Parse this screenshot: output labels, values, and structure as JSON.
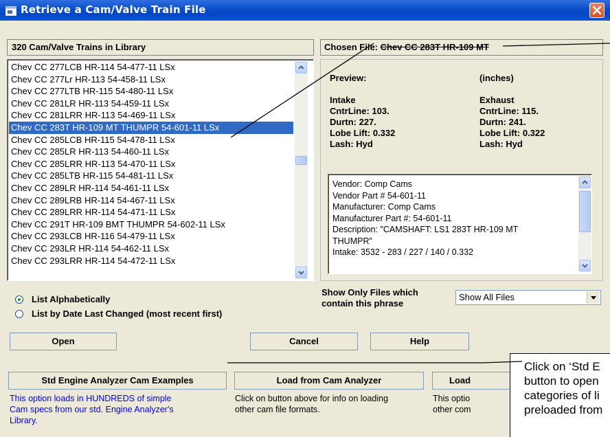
{
  "window": {
    "title": "Retrieve a Cam/Valve Train File",
    "close_label": "X"
  },
  "library": {
    "count_label": "320 Cam/Valve Trains in Library",
    "items": [
      "Chev CC  277LCB HR-114 54-477-11 LSx",
      "Chev CC  277Lr HR-113 54-458-11 LSx",
      "Chev CC  277LTB HR-115 54-480-11 LSx",
      "Chev CC  281LR HR-113 54-459-11 LSx",
      "Chev CC  281LRR HR-113 54-469-11 LSx",
      "Chev CC  283T HR-109 MT THUMPR 54-601-11 LSx",
      "Chev CC  285LCB HR-115 54-478-11 LSx",
      "Chev CC  285LR HR-113 54-460-11 LSx",
      "Chev CC  285LRR HR-113 54-470-11 LSx",
      "Chev CC  285LTB HR-115 54-481-11 LSx",
      "Chev CC  289LR HR-114 54-461-11 LSx",
      "Chev CC  289LRB HR-114 54-467-11 LSx",
      "Chev CC  289LRR HR-114 54-471-11 LSx",
      "Chev CC  291T HR-109 BMT THUMPR 54-602-11 LSx",
      "Chev CC  293LCB HR-116 54-479-11 LSx",
      "Chev CC  293LR HR-114 54-462-11 LSx",
      "Chev CC  293LRR HR-114 54-472-11 LSx"
    ],
    "selected_index": 5
  },
  "chosen": {
    "prefix": "Chosen File: ",
    "name": "Chev CC  283T HR-109 MT"
  },
  "preview": {
    "heading": "Preview:",
    "units": "(inches)",
    "intake": {
      "title": "Intake",
      "centerline": "CntrLine: 103.",
      "duration": "Durtn: 227.",
      "lobe_lift": "Lobe Lift: 0.332",
      "lash": "Lash: Hyd"
    },
    "exhaust": {
      "title": "Exhaust",
      "centerline": "CntrLine: 115.",
      "duration": "Durtn: 241.",
      "lobe_lift": "Lobe Lift: 0.322",
      "lash": "Lash: Hyd"
    },
    "notes": [
      "Vendor: Comp Cams",
      "Vendor Part # 54-601-11",
      "Manufacturer: Comp Cams",
      "Manufacturer Part #: 54-601-11",
      "Description: \"CAMSHAFT: LS1 283T HR-109 MT",
      "THUMPR\"",
      "Intake: 3532 - 283 / 227 / 140 / 0.332"
    ]
  },
  "sort": {
    "alphabetical": "List Alphabetically",
    "by_date": "List by Date Last Changed (most recent first)",
    "selected": "alphabetical"
  },
  "filter": {
    "label_line1": "Show Only Files which",
    "label_line2": "contain this phrase",
    "value": "Show All Files"
  },
  "buttons": {
    "open": "Open",
    "cancel": "Cancel",
    "help": "Help",
    "std_examples": "Std Engine Analyzer Cam Examples",
    "load_cam_analyzer": "Load from Cam Analyzer",
    "load_other": "Load"
  },
  "descriptions": {
    "std_line1": "This option loads in HUNDREDS of simple",
    "std_line2": "Cam specs from our std. Engine Analyzer's",
    "std_line3": "Library.",
    "cam_line1": "Click on button above for info on loading",
    "cam_line2": "other cam file formats.",
    "other_line1": "This optio",
    "other_line2": "other com"
  },
  "callout": {
    "lines": [
      "Click on ‘Std E",
      "button to open",
      "categories of li",
      "preloaded from"
    ]
  },
  "colors": {
    "title_bar": "#0a4fc9",
    "selection": "#316ac5",
    "description_blue": "#0000ff",
    "dialog_face": "#ece9d8"
  }
}
